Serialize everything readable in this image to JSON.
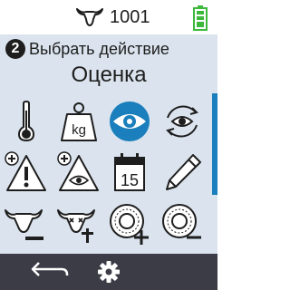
{
  "status": {
    "animal_id": "1001",
    "icons": [
      "cow-icon",
      "battery-full-icon"
    ],
    "battery_color": "#3cb83c"
  },
  "step": {
    "number": "2",
    "label": "Выбрать действие"
  },
  "title": "Оценка",
  "actions": [
    {
      "icon": "thermometer-icon",
      "label": ""
    },
    {
      "icon": "weight-kg-icon",
      "label": "kg",
      "selected": true
    },
    {
      "icon": "eye-icon",
      "label": "",
      "selected": true
    },
    {
      "icon": "eye-repeat-icon",
      "label": ""
    },
    {
      "icon": "warning-add-icon",
      "label": ""
    },
    {
      "icon": "eye-warning-add-icon",
      "label": ""
    },
    {
      "icon": "calendar-icon",
      "label": "15"
    },
    {
      "icon": "pencil-icon",
      "label": ""
    },
    {
      "icon": "cow-remove-icon",
      "label": ""
    },
    {
      "icon": "cow-dead-icon",
      "label": ""
    },
    {
      "icon": "tag-add-icon",
      "label": ""
    },
    {
      "icon": "tag-remove-icon",
      "label": ""
    }
  ],
  "bottom_bar": {
    "icons": [
      "back-icon",
      "gear-icon"
    ]
  },
  "colors": {
    "accent": "#1a7fbc",
    "background": "#dbe4ee",
    "bottom_bar": "#3c3c46"
  }
}
